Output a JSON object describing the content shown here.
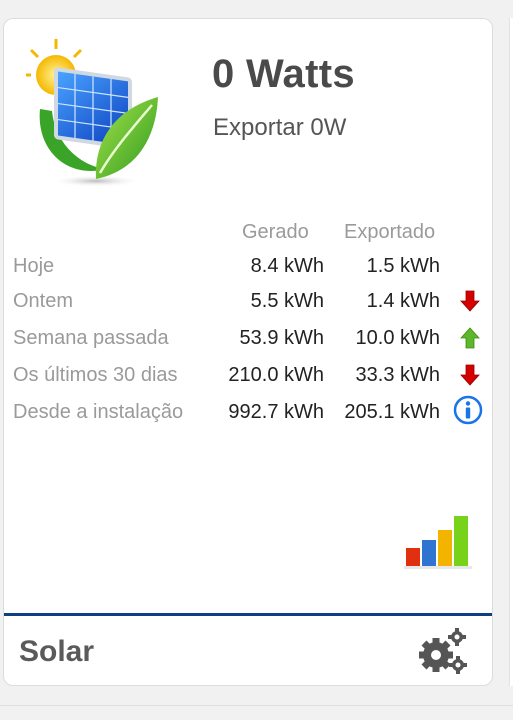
{
  "header": {
    "power": "0 Watts",
    "export_now": "Exportar 0W"
  },
  "table": {
    "columns": [
      "Gerado",
      "Exportado"
    ],
    "rows": [
      {
        "label": "Hoje",
        "generated": "8.4 kWh",
        "exported": "1.5 kWh",
        "trend": null
      },
      {
        "label": "Ontem",
        "generated": "5.5 kWh",
        "exported": "1.4 kWh",
        "trend": "down"
      },
      {
        "label": "Semana passada",
        "generated": "53.9 kWh",
        "exported": "10.0 kWh",
        "trend": "up"
      },
      {
        "label": "Os últimos 30 dias",
        "generated": "210.0 kWh",
        "exported": "33.3 kWh",
        "trend": "down"
      },
      {
        "label": "Desde a instalação",
        "generated": "992.7 kWh",
        "exported": "205.1 kWh",
        "trend": "info"
      }
    ]
  },
  "footer": {
    "title": "Solar"
  },
  "icons": {
    "logo": "solar-panel-leaf-icon",
    "trend_down": "arrow-down-icon",
    "trend_up": "arrow-up-icon",
    "info": "info-icon",
    "chart": "bar-chart-icon",
    "settings": "gears-icon"
  },
  "colors": {
    "accent_line": "#0d3f82",
    "arrow_down": "#d40000",
    "arrow_up": "#5cb82a",
    "info": "#1a73e8"
  }
}
